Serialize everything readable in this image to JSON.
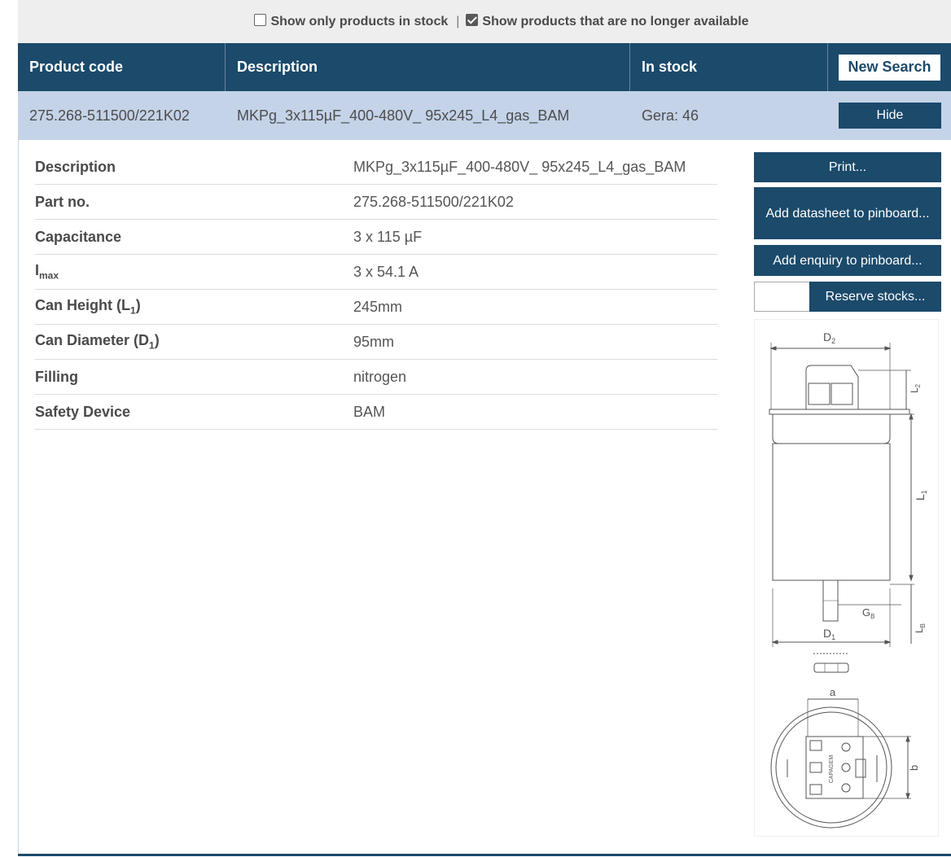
{
  "filters": {
    "in_stock_label": "Show only products in stock",
    "in_stock_checked": false,
    "separator": "|",
    "unavailable_label": "Show products that are no longer available",
    "unavailable_checked": true
  },
  "table_header": {
    "product_code": "Product code",
    "description": "Description",
    "in_stock": "In stock",
    "new_search": "New Search"
  },
  "result": {
    "product_code": "275.268-511500/221K02",
    "description": "MKPg_3x115µF_400-480V_ 95x245_L4_gas_BAM",
    "stock": "Gera: 46",
    "hide": "Hide"
  },
  "properties": [
    {
      "label": "Description",
      "value": "MKPg_3x115µF_400-480V_ 95x245_L4_gas_BAM"
    },
    {
      "label": "Part no.",
      "value": "275.268-511500/221K02"
    },
    {
      "label": "Capacitance",
      "value": "3 x 115 µF"
    },
    {
      "label_main": "I",
      "label_sub": "max",
      "value": "3 x 54.1 A"
    },
    {
      "label_main": "Can Height (L",
      "label_sub": "1",
      "label_end": ")",
      "value": "245mm"
    },
    {
      "label_main": "Can Diameter (D",
      "label_sub": "1",
      "label_end": ")",
      "value": "95mm"
    },
    {
      "label": "Filling",
      "value": "nitrogen"
    },
    {
      "label": "Safety Device",
      "value": "BAM"
    }
  ],
  "actions": {
    "print": "Print...",
    "add_datasheet": "Add datasheet to pinboard...",
    "add_enquiry": "Add enquiry to pinboard...",
    "quantity_value": "",
    "reserve": "Reserve stocks..."
  },
  "drawing": {
    "labels": {
      "d2": "D",
      "d2_sub": "2",
      "l2": "L",
      "l2_sub": "2",
      "l1": "L",
      "l1_sub": "1",
      "gb": "G",
      "gb_sub": "B",
      "d1": "D",
      "d1_sub": "1",
      "lb": "L",
      "lb_sub": "B",
      "a": "a",
      "b": "b",
      "brand": "CAPAGEM"
    }
  },
  "colors": {
    "header_bg": "#1b4a6b",
    "row_bg": "#c4d3e8",
    "filter_bg": "#eeeeee"
  }
}
